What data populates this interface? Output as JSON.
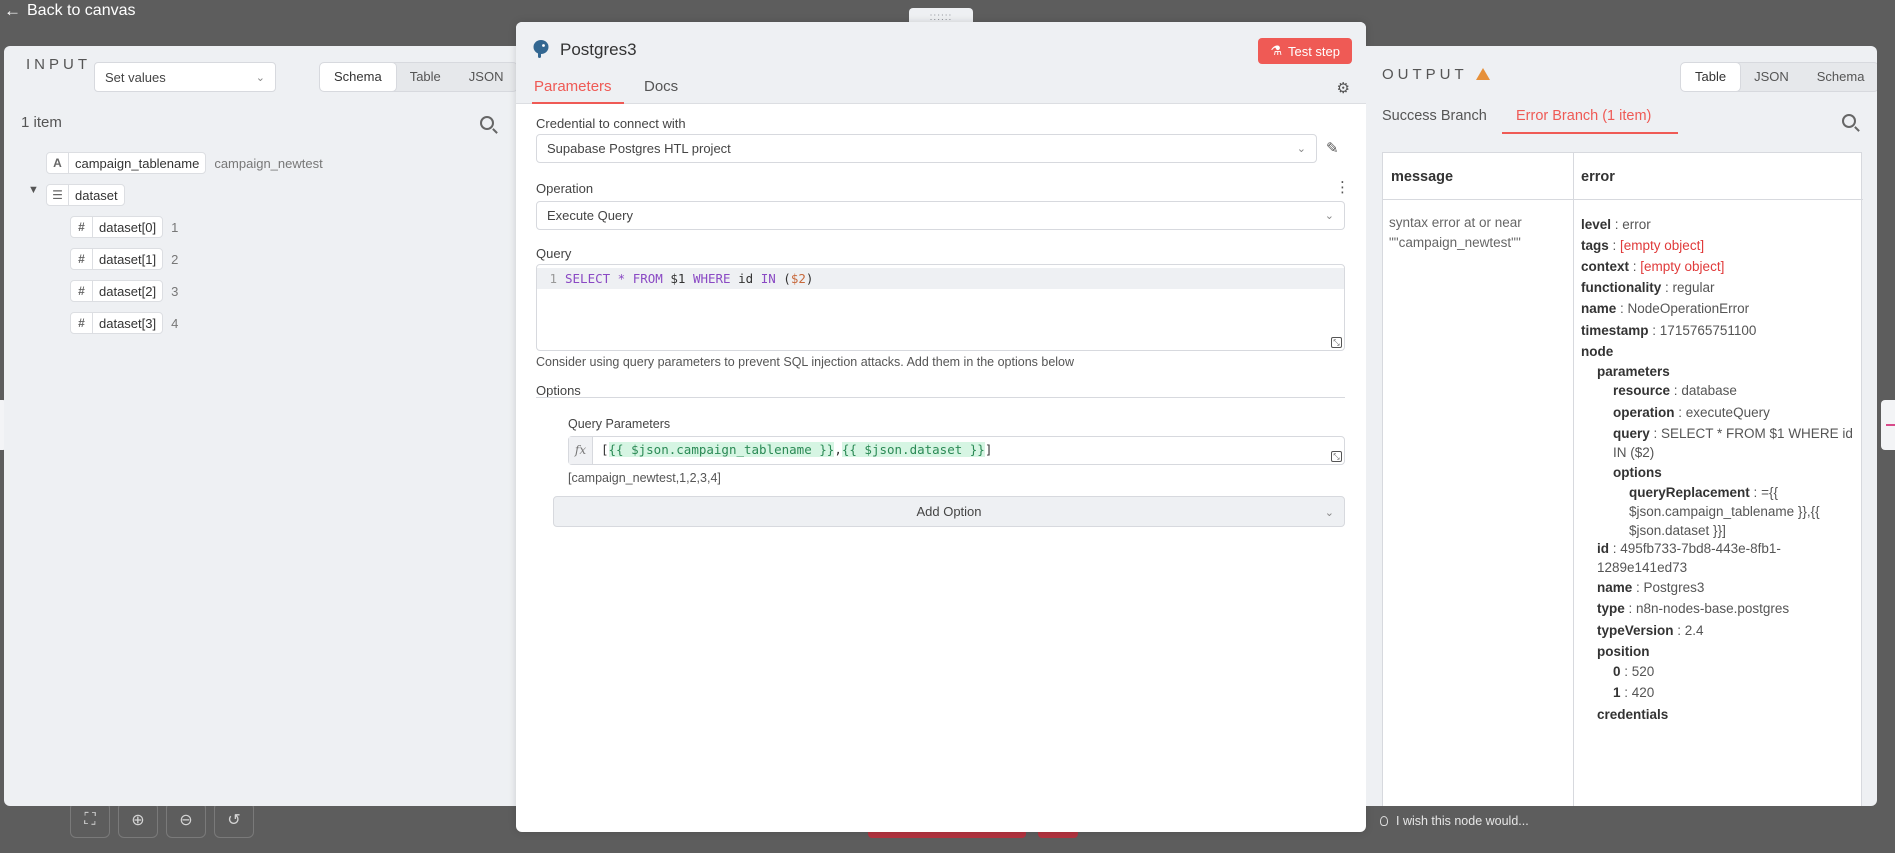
{
  "overlay": {
    "back_label": "Back to canvas",
    "drag_handle": "::::::",
    "wish_text": "I wish this node would..."
  },
  "input_panel": {
    "label": "INPUT",
    "source_select": "Set values",
    "view_tabs": [
      "Schema",
      "Table",
      "JSON"
    ],
    "active_view": "Schema",
    "item_count": "1 item",
    "schema": [
      {
        "type": "A",
        "key": "campaign_tablename",
        "value": "campaign_newtest"
      },
      {
        "type": "list",
        "key": "dataset",
        "value": ""
      },
      {
        "type": "#",
        "key": "dataset[0]",
        "value": "1"
      },
      {
        "type": "#",
        "key": "dataset[1]",
        "value": "2"
      },
      {
        "type": "#",
        "key": "dataset[2]",
        "value": "3"
      },
      {
        "type": "#",
        "key": "dataset[3]",
        "value": "4"
      }
    ]
  },
  "node": {
    "title": "Postgres3",
    "test_button": "Test step",
    "tabs": [
      "Parameters",
      "Docs"
    ],
    "credential_label": "Credential to connect with",
    "credential_value": "Supabase Postgres HTL project",
    "operation_label": "Operation",
    "operation_value": "Execute Query",
    "query_label": "Query",
    "query_line_number": "1",
    "query_tokens": {
      "select": "SELECT",
      "star": " * ",
      "from": "FROM",
      "p1": " $1 ",
      "where": "WHERE",
      "id": " id ",
      "in": "IN",
      "open": " (",
      "p2": "$2",
      "close": ")"
    },
    "query_hint": "Consider using query parameters to prevent SQL injection attacks. Add them in the options below",
    "options_label": "Options",
    "query_params_label": "Query Parameters",
    "expr": {
      "fx": "fx",
      "open": "[",
      "part1": "{{ $json.campaign_tablename }}",
      "comma": ",",
      "part2": "{{ $json.dataset }}",
      "close": "]"
    },
    "expr_result": "[campaign_newtest,1,2,3,4]",
    "add_option": "Add Option"
  },
  "output_panel": {
    "label": "OUTPUT",
    "view_tabs": [
      "Table",
      "JSON",
      "Schema"
    ],
    "active_view": "Table",
    "branch_tabs": [
      "Success Branch",
      "Error Branch (1 item)"
    ],
    "active_branch": "Error Branch (1 item)",
    "columns": [
      "message",
      "error"
    ],
    "message_value": "syntax error at or near \"\"campaign_newtest\"\"",
    "error_tree": [
      {
        "k": "level",
        "v": "error"
      },
      {
        "k": "tags",
        "v": "[empty object]"
      },
      {
        "k": "context",
        "v": "[empty object]"
      },
      {
        "k": "functionality",
        "v": "regular"
      },
      {
        "k": "name",
        "v": "NodeOperationError"
      },
      {
        "k": "timestamp",
        "v": "1715765751100"
      },
      {
        "k": "node",
        "v": ""
      },
      {
        "k": "parameters",
        "v": ""
      },
      {
        "k": "resource",
        "v": "database"
      },
      {
        "k": "operation",
        "v": "executeQuery"
      },
      {
        "k": "query",
        "v": "SELECT * FROM $1 WHERE id IN ($2)"
      },
      {
        "k": "options",
        "v": ""
      },
      {
        "k": "queryReplacement",
        "v": "={{ $json.campaign_tablename }},{{ $json.dataset }}]"
      },
      {
        "k": "id",
        "v": "495fb733-7bd8-443e-8fb1-1289e141ed73"
      },
      {
        "k": "name",
        "v": "Postgres3"
      },
      {
        "k": "type",
        "v": "n8n-nodes-base.postgres"
      },
      {
        "k": "typeVersion",
        "v": "2.4"
      },
      {
        "k": "position",
        "v": ""
      },
      {
        "k": "0",
        "v": "520"
      },
      {
        "k": "1",
        "v": "420"
      },
      {
        "k": "credentials",
        "v": ""
      }
    ]
  },
  "colors": {
    "accent": "#ef5a55",
    "warning": "#e6903a",
    "error_text": "#e03a3a",
    "expression_green": "#2b8a55"
  },
  "icons": [
    "arrow-left-icon",
    "postgres-elephant-icon",
    "flask-icon",
    "gear-icon",
    "search-icon",
    "pencil-icon",
    "kebab-icon",
    "chevron-down-icon",
    "resize-icon",
    "warning-icon",
    "lightbulb-icon",
    "fit-view-icon",
    "zoom-in-icon",
    "zoom-out-icon",
    "reset-icon"
  ]
}
